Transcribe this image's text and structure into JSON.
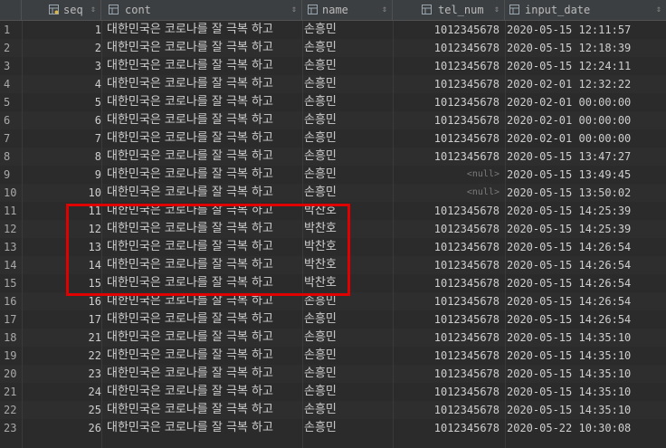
{
  "columns": [
    {
      "label": "seq",
      "icon": "key-column-icon"
    },
    {
      "label": "cont",
      "icon": "column-icon"
    },
    {
      "label": "name",
      "icon": "column-icon"
    },
    {
      "label": "tel_num",
      "icon": "column-icon"
    },
    {
      "label": "input_date",
      "icon": "column-icon"
    }
  ],
  "sort_arrow": "⇕",
  "rows": [
    {
      "n": "1",
      "seq": "1",
      "cont": "대한민국은 코로나를 잘 극복 하고",
      "name": "손흥민",
      "tel": "1012345678",
      "date": "2020-05-15 12:11:57"
    },
    {
      "n": "2",
      "seq": "2",
      "cont": "대한민국은 코로나를 잘 극복 하고",
      "name": "손흥민",
      "tel": "1012345678",
      "date": "2020-05-15 12:18:39"
    },
    {
      "n": "3",
      "seq": "3",
      "cont": "대한민국은 코로나를 잘 극복 하고",
      "name": "손흥민",
      "tel": "1012345678",
      "date": "2020-05-15 12:24:11"
    },
    {
      "n": "4",
      "seq": "4",
      "cont": "대한민국은 코로나를 잘 극복 하고",
      "name": "손흥민",
      "tel": "1012345678",
      "date": "2020-02-01 12:32:22"
    },
    {
      "n": "5",
      "seq": "5",
      "cont": "대한민국은 코로나를 잘 극복 하고",
      "name": "손흥민",
      "tel": "1012345678",
      "date": "2020-02-01 00:00:00"
    },
    {
      "n": "6",
      "seq": "6",
      "cont": "대한민국은 코로나를 잘 극복 하고",
      "name": "손흥민",
      "tel": "1012345678",
      "date": "2020-02-01 00:00:00"
    },
    {
      "n": "7",
      "seq": "7",
      "cont": "대한민국은 코로나를 잘 극복 하고",
      "name": "손흥민",
      "tel": "1012345678",
      "date": "2020-02-01 00:00:00"
    },
    {
      "n": "8",
      "seq": "8",
      "cont": "대한민국은 코로나를 잘 극복 하고",
      "name": "손흥민",
      "tel": "1012345678",
      "date": "2020-05-15 13:47:27"
    },
    {
      "n": "9",
      "seq": "9",
      "cont": "대한민국은 코로나를 잘 극복 하고",
      "name": "손흥민",
      "tel": "<null>",
      "date": "2020-05-15 13:49:45"
    },
    {
      "n": "10",
      "seq": "10",
      "cont": "대한민국은 코로나를 잘 극복 하고",
      "name": "손흥민",
      "tel": "<null>",
      "date": "2020-05-15 13:50:02"
    },
    {
      "n": "11",
      "seq": "11",
      "cont": "대한민국은 코로나를 잘 극복 하고",
      "name": "박찬호",
      "tel": "1012345678",
      "date": "2020-05-15 14:25:39"
    },
    {
      "n": "12",
      "seq": "12",
      "cont": "대한민국은 코로나를 잘 극복 하고",
      "name": "박찬호",
      "tel": "1012345678",
      "date": "2020-05-15 14:25:39"
    },
    {
      "n": "13",
      "seq": "13",
      "cont": "대한민국은 코로나를 잘 극복 하고",
      "name": "박찬호",
      "tel": "1012345678",
      "date": "2020-05-15 14:26:54"
    },
    {
      "n": "14",
      "seq": "14",
      "cont": "대한민국은 코로나를 잘 극복 하고",
      "name": "박찬호",
      "tel": "1012345678",
      "date": "2020-05-15 14:26:54"
    },
    {
      "n": "15",
      "seq": "15",
      "cont": "대한민국은 코로나를 잘 극복 하고",
      "name": "박찬호",
      "tel": "1012345678",
      "date": "2020-05-15 14:26:54"
    },
    {
      "n": "16",
      "seq": "16",
      "cont": "대한민국은 코로나를 잘 극복 하고",
      "name": "손흥민",
      "tel": "1012345678",
      "date": "2020-05-15 14:26:54"
    },
    {
      "n": "17",
      "seq": "17",
      "cont": "대한민국은 코로나를 잘 극복 하고",
      "name": "손흥민",
      "tel": "1012345678",
      "date": "2020-05-15 14:26:54"
    },
    {
      "n": "18",
      "seq": "21",
      "cont": "대한민국은 코로나를 잘 극복 하고",
      "name": "손흥민",
      "tel": "1012345678",
      "date": "2020-05-15 14:35:10"
    },
    {
      "n": "19",
      "seq": "22",
      "cont": "대한민국은 코로나를 잘 극복 하고",
      "name": "손흥민",
      "tel": "1012345678",
      "date": "2020-05-15 14:35:10"
    },
    {
      "n": "20",
      "seq": "23",
      "cont": "대한민국은 코로나를 잘 극복 하고",
      "name": "손흥민",
      "tel": "1012345678",
      "date": "2020-05-15 14:35:10"
    },
    {
      "n": "21",
      "seq": "24",
      "cont": "대한민국은 코로나를 잘 극복 하고",
      "name": "손흥민",
      "tel": "1012345678",
      "date": "2020-05-15 14:35:10"
    },
    {
      "n": "22",
      "seq": "25",
      "cont": "대한민국은 코로나를 잘 극복 하고",
      "name": "손흥민",
      "tel": "1012345678",
      "date": "2020-05-15 14:35:10"
    },
    {
      "n": "23",
      "seq": "26",
      "cont": "대한민국은 코로나를 잘 극복 하고",
      "name": "손흥민",
      "tel": "1012345678",
      "date": "2020-05-22 10:30:08"
    }
  ],
  "colors": {
    "highlight": "#e00000",
    "background": "#2b2b2b",
    "header": "#3c3f41"
  }
}
